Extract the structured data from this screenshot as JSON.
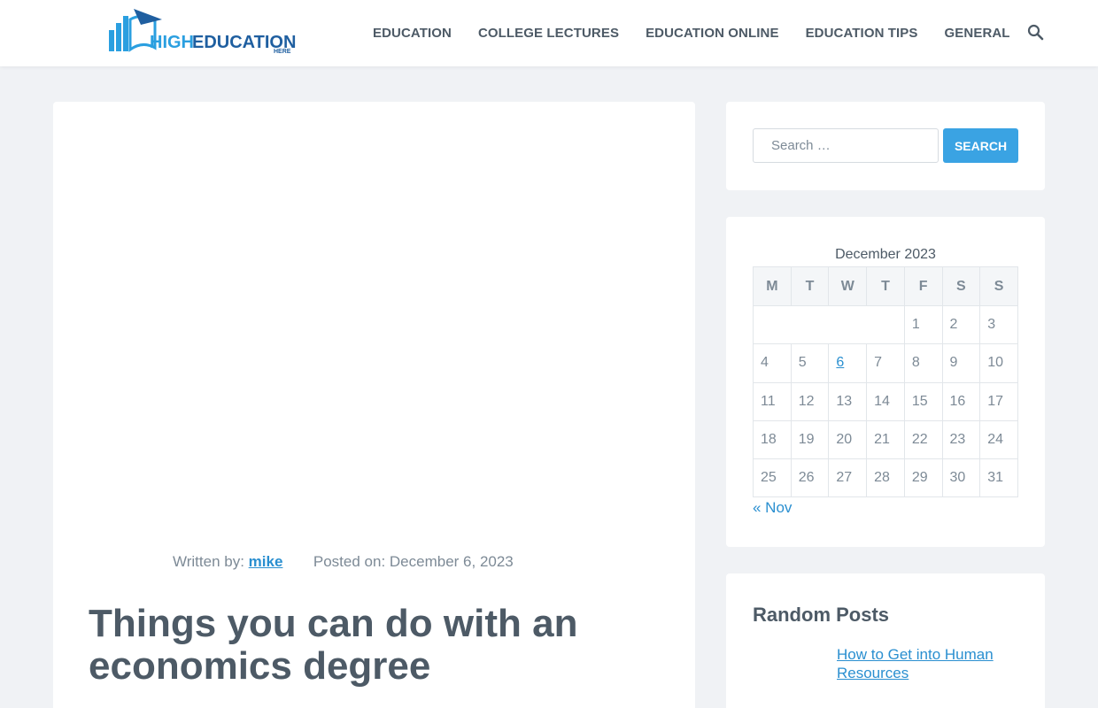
{
  "header": {
    "logo": {
      "text_high": "HIGH",
      "text_education": "EDUCATION",
      "text_here": "HERE",
      "colors": {
        "high": "#2a9fe0",
        "education": "#1f5fa0",
        "icon": "#2a9fe0"
      }
    },
    "nav": [
      {
        "label": "EDUCATION"
      },
      {
        "label": "COLLEGE LECTURES"
      },
      {
        "label": "EDUCATION ONLINE"
      },
      {
        "label": "EDUCATION TIPS"
      },
      {
        "label": "GENERAL"
      }
    ],
    "search_icon": "search-icon"
  },
  "post": {
    "meta_written_label": "Written by:",
    "author": "mike",
    "meta_posted_label": "Posted on:",
    "date": "December 6, 2023",
    "title": "Things you can do with an economics degree"
  },
  "sidebar": {
    "search": {
      "placeholder": "Search …",
      "button_label": "SEARCH"
    },
    "calendar": {
      "caption": "December 2023",
      "weekdays": [
        "M",
        "T",
        "W",
        "T",
        "F",
        "S",
        "S"
      ],
      "weeks": [
        [
          "",
          "",
          "",
          "",
          "1",
          "2",
          "3"
        ],
        [
          "4",
          "5",
          "6",
          "7",
          "8",
          "9",
          "10"
        ],
        [
          "11",
          "12",
          "13",
          "14",
          "15",
          "16",
          "17"
        ],
        [
          "18",
          "19",
          "20",
          "21",
          "22",
          "23",
          "24"
        ],
        [
          "25",
          "26",
          "27",
          "28",
          "29",
          "30",
          "31"
        ]
      ],
      "linked_day": "6",
      "prev_label": "« Nov"
    },
    "random_posts": {
      "title": "Random Posts",
      "items": [
        {
          "label": "How to Get into Human Resources"
        }
      ]
    }
  },
  "colors": {
    "accent": "#3aa3e3",
    "link": "#2a8fd0",
    "text": "#4d5a66",
    "muted": "#7d8a96",
    "background": "#f0f2f5"
  }
}
